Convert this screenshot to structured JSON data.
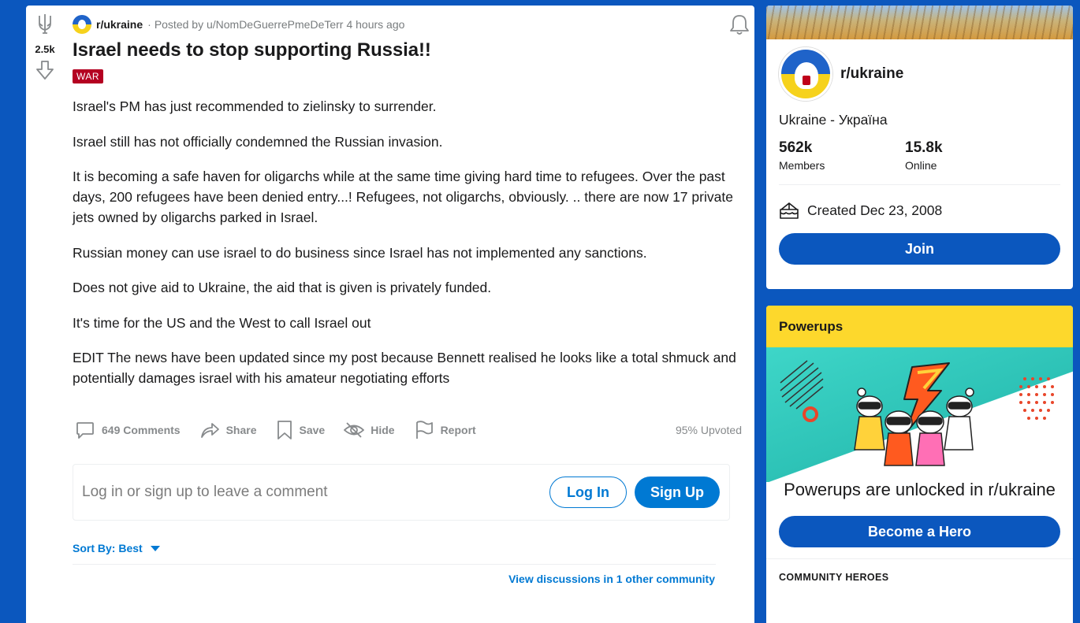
{
  "post": {
    "score": "2.5k",
    "subreddit": "r/ukraine",
    "posted_by": "Posted by u/NomDeGuerrePmeDeTerr",
    "time_ago": "4 hours ago",
    "title": "Israel needs to stop supporting Russia!!",
    "flair": "WAR",
    "paragraphs": [
      "Israel's PM has just recommended to zielinsky to surrender.",
      "Israel still has not officially condemned the Russian invasion.",
      "It is becoming a safe haven for oligarchs while at the same time giving hard time to refugees. Over the past days, 200 refugees have been denied entry...! Refugees, not oligarchs, obviously. .. there are now 17 private jets owned by oligarchs parked in Israel.",
      "Russian money can use israel to do business since Israel has not implemented any sanctions.",
      "Does not give aid to Ukraine, the aid that is given is privately funded.",
      "It's time for the US and the West to call Israel out",
      "EDIT The news have been updated since my post because Bennett realised he looks like a total shmuck and potentially damages israel with his amateur negotiating efforts"
    ],
    "actions": {
      "comments": "649 Comments",
      "share": "Share",
      "save": "Save",
      "hide": "Hide",
      "report": "Report",
      "upvoted": "95% Upvoted"
    }
  },
  "comment_box": {
    "prompt": "Log in or sign up to leave a comment",
    "login": "Log In",
    "signup": "Sign Up"
  },
  "sort": {
    "label": "Sort By: Best"
  },
  "view_discussions": "View discussions in 1 other community",
  "sidebar": {
    "about": {
      "name": "r/ukraine",
      "title": "Ukraine - Україна",
      "members_num": "562k",
      "members_label": "Members",
      "online_num": "15.8k",
      "online_label": "Online",
      "created": "Created Dec 23, 2008",
      "join": "Join"
    },
    "powerups": {
      "header": "Powerups",
      "text": "Powerups are unlocked in r/ukraine",
      "button": "Become a Hero",
      "heroes": "COMMUNITY HEROES"
    }
  },
  "colors": {
    "page_bg": "#0b57be",
    "primary_button": "#0b57be",
    "link_blue": "#0079d3",
    "flair_bg": "#b40021",
    "powerups_yellow": "#fdd82c",
    "powerups_teal": "#3ed6c8"
  }
}
